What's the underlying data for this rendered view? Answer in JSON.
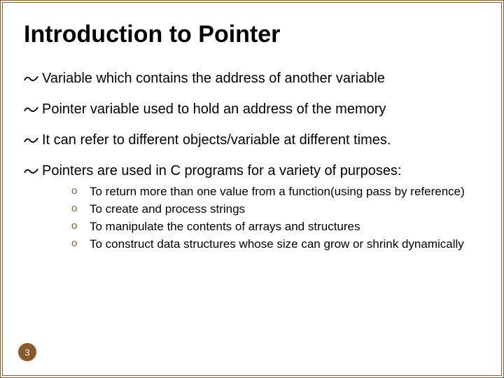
{
  "title": "Introduction to Pointer",
  "bullets": [
    {
      "text": "Variable which contains the address of another variable"
    },
    {
      "text": "Pointer variable used to hold an address of the memory"
    },
    {
      "text": "It can refer to different objects/variable at different times."
    },
    {
      "text": "Pointers are used in C programs for a variety of purposes:"
    }
  ],
  "sublist": [
    "To return more than one value from a function(using pass by reference)",
    "To create and process strings",
    "To manipulate the contents of arrays and structures",
    "To construct data structures whose size can grow or shrink dynamically"
  ],
  "page_number": "3",
  "colors": {
    "accent": "#8a5a2a"
  }
}
